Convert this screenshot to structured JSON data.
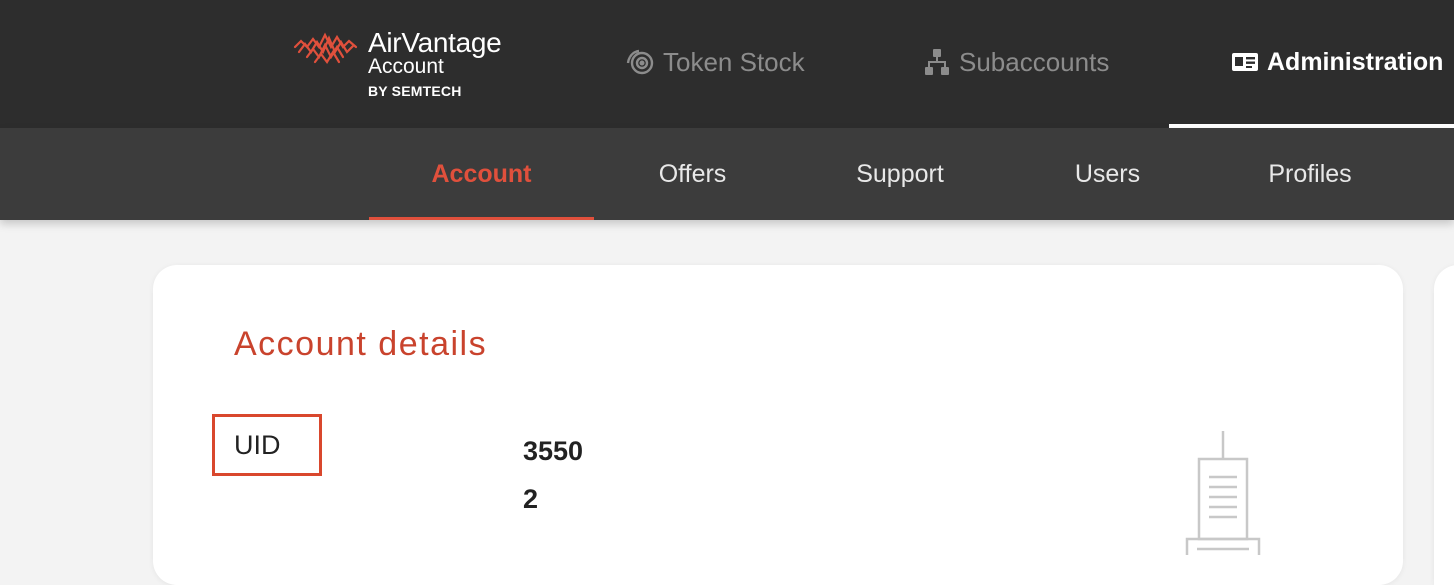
{
  "brand": {
    "name": "AirVantage",
    "subtitle": "Account",
    "by_line": "BY SEMTECH",
    "accent_color": "#e0503c"
  },
  "top_nav": {
    "items": [
      {
        "label": "Token Stock",
        "icon": "token-stock-icon",
        "active": false
      },
      {
        "label": "Subaccounts",
        "icon": "hierarchy-icon",
        "active": false
      },
      {
        "label": "Administration",
        "icon": "id-card-icon",
        "active": true
      }
    ]
  },
  "sub_nav": {
    "items": [
      {
        "label": "Account",
        "active": true
      },
      {
        "label": "Offers",
        "active": false
      },
      {
        "label": "Support",
        "active": false
      },
      {
        "label": "Users",
        "active": false
      },
      {
        "label": "Profiles",
        "active": false
      }
    ]
  },
  "account_details": {
    "title": "Account details",
    "uid_label": "UID",
    "uid_value_visible": "3550\n2",
    "illustration_icon": "building-icon"
  }
}
